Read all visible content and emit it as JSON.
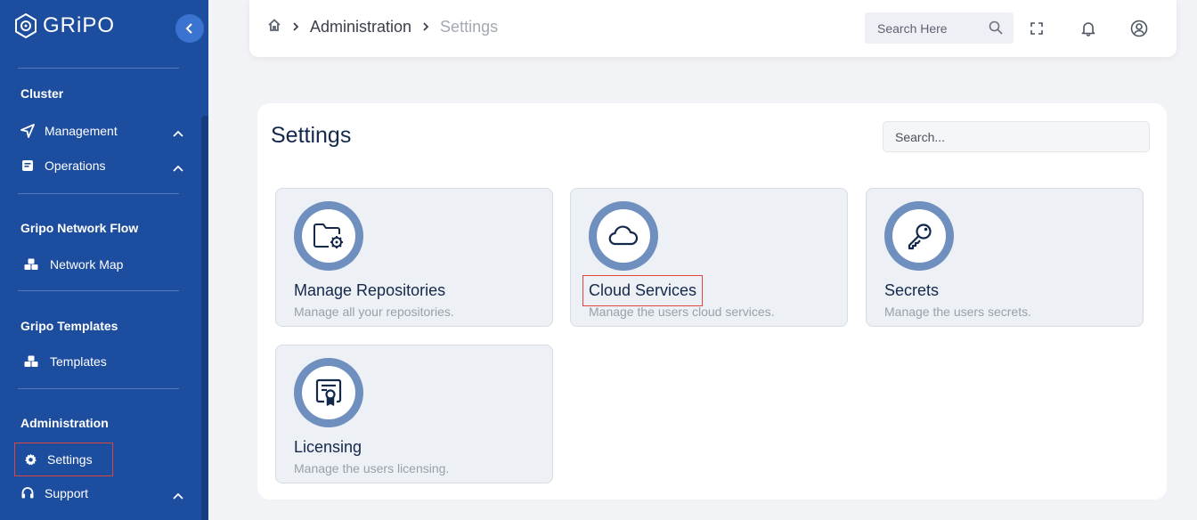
{
  "app": {
    "logo_text": "GRiPO"
  },
  "sidebar": {
    "sections": [
      {
        "title": "Cluster"
      },
      {
        "title": "Gripo Network Flow"
      },
      {
        "title": "Gripo Templates"
      },
      {
        "title": "Administration"
      }
    ],
    "items": [
      {
        "label": "Management",
        "icon": "send-icon"
      },
      {
        "label": "Operations",
        "icon": "document-icon"
      },
      {
        "label": "Network Map",
        "icon": "cubes-icon"
      },
      {
        "label": "Templates",
        "icon": "cubes-icon"
      },
      {
        "label": "Settings",
        "icon": "gear-icon"
      },
      {
        "label": "Support",
        "icon": "headset-icon"
      }
    ]
  },
  "topbar": {
    "breadcrumb": [
      "Administration",
      "Settings"
    ],
    "search_placeholder": "Search Here"
  },
  "main": {
    "title": "Settings",
    "search_placeholder": "Search...",
    "tiles": [
      {
        "title": "Manage Repositories",
        "description": "Manage all your repositories.",
        "icon": "folder-gear-icon"
      },
      {
        "title": "Cloud Services",
        "description": "Manage the users cloud services.",
        "icon": "cloud-icon"
      },
      {
        "title": "Secrets",
        "description": "Manage the users secrets.",
        "icon": "key-icon"
      },
      {
        "title": "Licensing",
        "description": "Manage the users licensing.",
        "icon": "certificate-icon"
      }
    ]
  },
  "colors": {
    "sidebar": "#1d4d9e",
    "accent": "#3b73d1",
    "ring": "#6f8fbf",
    "highlight": "#e0453d"
  }
}
